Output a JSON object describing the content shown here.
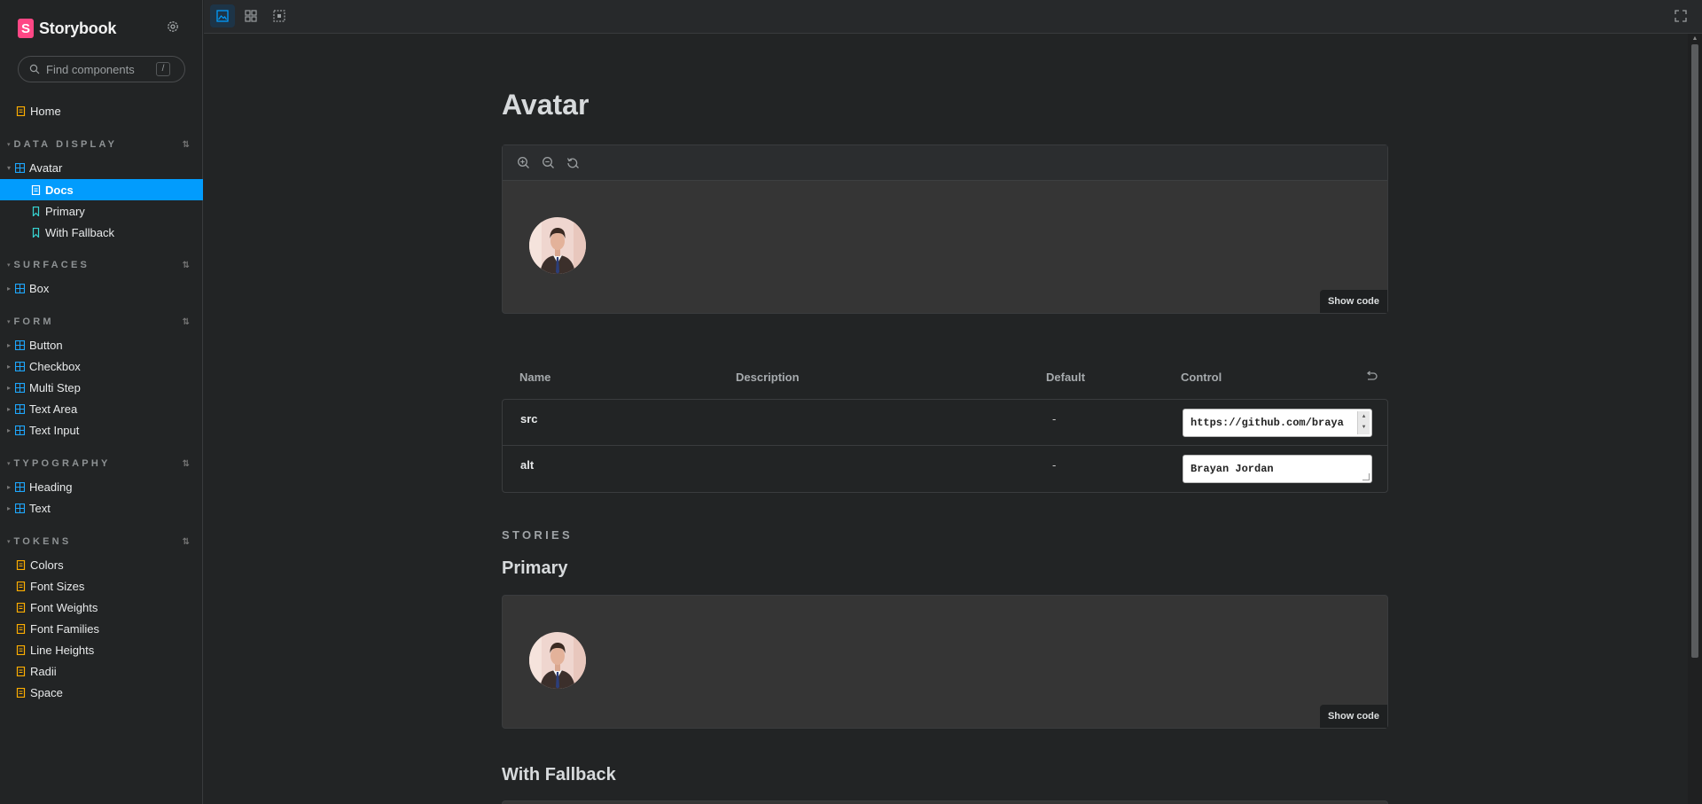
{
  "sidebar": {
    "brand": "Storybook",
    "search": {
      "placeholder": "Find components",
      "shortcut": "/"
    },
    "home": "Home",
    "sections": [
      {
        "title": "DATA DISPLAY"
      },
      {
        "title": "SURFACES"
      },
      {
        "title": "FORM"
      },
      {
        "title": "TYPOGRAPHY"
      },
      {
        "title": "TOKENS"
      }
    ],
    "items": {
      "avatar": "Avatar",
      "docs": "Docs",
      "primary": "Primary",
      "with_fallback": "With Fallback",
      "box": "Box",
      "button": "Button",
      "checkbox": "Checkbox",
      "multi_step": "Multi Step",
      "text_area": "Text Area",
      "text_input": "Text Input",
      "heading": "Heading",
      "text": "Text",
      "colors": "Colors",
      "font_sizes": "Font Sizes",
      "font_weights": "Font Weights",
      "font_families": "Font Families",
      "line_heights": "Line Heights",
      "radii": "Radii",
      "space": "Space"
    }
  },
  "docs": {
    "title": "Avatar",
    "show_code": "Show code",
    "args": {
      "headers": {
        "name": "Name",
        "description": "Description",
        "default": "Default",
        "control": "Control"
      },
      "rows": [
        {
          "name": "src",
          "default": "-",
          "value": "https://github.com/braya"
        },
        {
          "name": "alt",
          "default": "-",
          "value": "Brayan Jordan"
        }
      ]
    },
    "stories_label": "STORIES",
    "stories": [
      "Primary",
      "With Fallback"
    ]
  },
  "colors": {
    "accent": "#029cfd",
    "brand": "#ff4785",
    "component_icon": "#1ea7fd",
    "doc_icon": "#ffae00",
    "story_icon": "#37d5d3"
  }
}
